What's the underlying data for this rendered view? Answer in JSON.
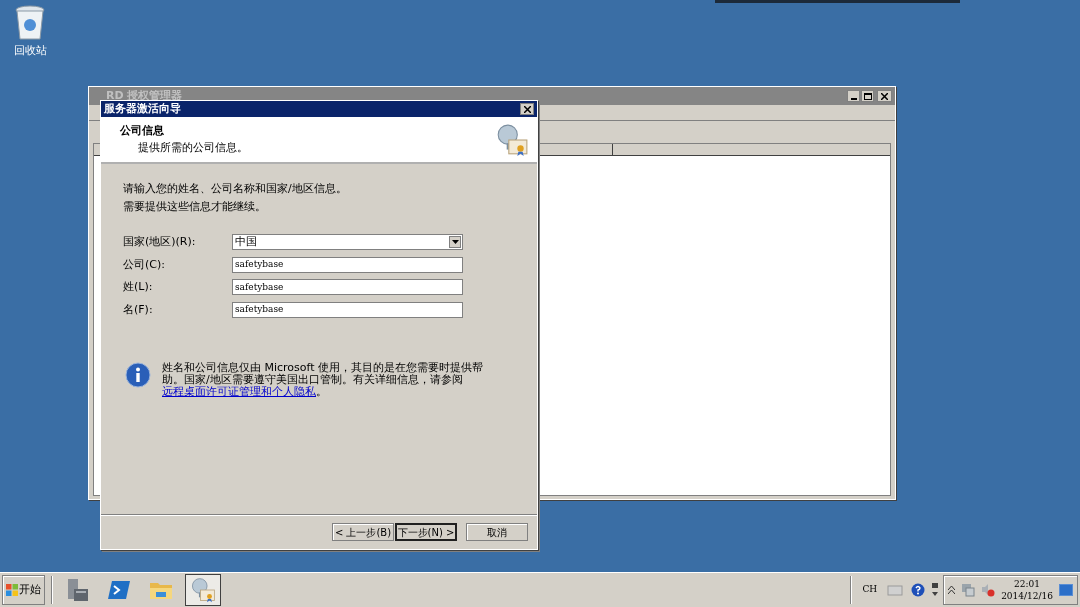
{
  "desktop": {
    "icons": [
      {
        "label": "回收站"
      }
    ]
  },
  "back_window": {
    "title": "RD 授权管理器"
  },
  "dialog": {
    "title": "服务器激活向导",
    "header": {
      "title": "公司信息",
      "subtitle": "提供所需的公司信息。"
    },
    "instructions": [
      "请输入您的姓名、公司名称和国家/地区信息。",
      "需要提供这些信息才能继续。"
    ],
    "fields": [
      {
        "kind": "select",
        "label": "国家(地区)(R):",
        "value": "中国"
      },
      {
        "kind": "text",
        "label": "公司(C):",
        "value": "safetybase"
      },
      {
        "kind": "text",
        "label": "姓(L):",
        "value": "safetybase"
      },
      {
        "kind": "text",
        "label": "名(F):",
        "value": "safetybase"
      }
    ],
    "note": {
      "text": "姓名和公司信息仅由 Microsoft 使用，其目的是在您需要时提供帮助。国家/地区需要遵守美国出口管制。有关详细信息，请参阅",
      "link": "远程桌面许可证管理和个人隐私",
      "suffix": "。"
    },
    "buttons": [
      {
        "label": "< 上一步(B)",
        "default": false
      },
      {
        "label": "下一步(N) >",
        "default": true
      },
      {
        "label": "取消",
        "default": false
      }
    ]
  },
  "taskbar": {
    "start": "开始",
    "apps": [
      {
        "kind": "server",
        "selected": false
      },
      {
        "kind": "powershell",
        "selected": false
      },
      {
        "kind": "folder",
        "selected": false
      },
      {
        "kind": "licensing",
        "selected": true
      }
    ],
    "tray": {
      "language": "CH",
      "time": "22:01",
      "date": "2014/12/16"
    }
  }
}
